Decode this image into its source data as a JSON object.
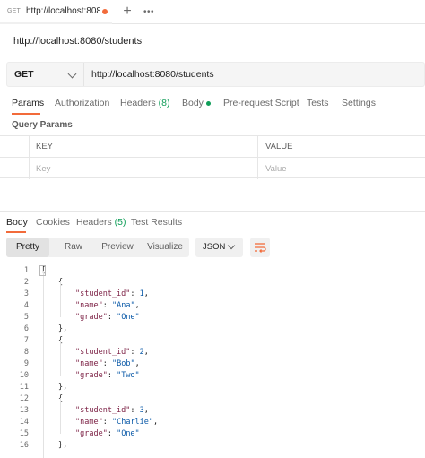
{
  "tab": {
    "method": "GET",
    "title": "http://localhost:8080/s",
    "unsaved_color": "#f26b3a"
  },
  "request": {
    "title": "http://localhost:8080/students",
    "method": "GET",
    "url": "http://localhost:8080/students"
  },
  "request_tabs": [
    {
      "label": "Params"
    },
    {
      "label": "Authorization"
    },
    {
      "label": "Headers",
      "count": "(8)"
    },
    {
      "label": "Body"
    },
    {
      "label": "Pre-request Script"
    },
    {
      "label": "Tests"
    },
    {
      "label": "Settings"
    }
  ],
  "query_params": {
    "label": "Query Params",
    "headers": [
      "KEY",
      "VALUE"
    ],
    "key_placeholder": "Key",
    "value_placeholder": "Value"
  },
  "response_tabs": [
    {
      "label": "Body"
    },
    {
      "label": "Cookies"
    },
    {
      "label": "Headers",
      "count": "(5)"
    },
    {
      "label": "Test Results"
    }
  ],
  "response_toolbar": {
    "modes": [
      "Pretty",
      "Raw",
      "Preview",
      "Visualize"
    ],
    "format": "JSON"
  },
  "code_lines": [
    {
      "n": "1",
      "indent": 0,
      "tokens": [
        [
          "p",
          "["
        ]
      ]
    },
    {
      "n": "2",
      "indent": 1,
      "tokens": [
        [
          "p",
          "{"
        ]
      ]
    },
    {
      "n": "3",
      "indent": 2,
      "tokens": [
        [
          "k",
          "\"student_id\""
        ],
        [
          "p",
          ": "
        ],
        [
          "n",
          "1"
        ],
        [
          "p",
          ","
        ]
      ]
    },
    {
      "n": "4",
      "indent": 2,
      "tokens": [
        [
          "k",
          "\"name\""
        ],
        [
          "p",
          ": "
        ],
        [
          "s",
          "\"Ana\""
        ],
        [
          "p",
          ","
        ]
      ]
    },
    {
      "n": "5",
      "indent": 2,
      "tokens": [
        [
          "k",
          "\"grade\""
        ],
        [
          "p",
          ": "
        ],
        [
          "s",
          "\"One\""
        ]
      ]
    },
    {
      "n": "6",
      "indent": 1,
      "tokens": [
        [
          "p",
          "},"
        ]
      ]
    },
    {
      "n": "7",
      "indent": 1,
      "tokens": [
        [
          "p",
          "{"
        ]
      ]
    },
    {
      "n": "8",
      "indent": 2,
      "tokens": [
        [
          "k",
          "\"student_id\""
        ],
        [
          "p",
          ": "
        ],
        [
          "n",
          "2"
        ],
        [
          "p",
          ","
        ]
      ]
    },
    {
      "n": "9",
      "indent": 2,
      "tokens": [
        [
          "k",
          "\"name\""
        ],
        [
          "p",
          ": "
        ],
        [
          "s",
          "\"Bob\""
        ],
        [
          "p",
          ","
        ]
      ]
    },
    {
      "n": "10",
      "indent": 2,
      "tokens": [
        [
          "k",
          "\"grade\""
        ],
        [
          "p",
          ": "
        ],
        [
          "s",
          "\"Two\""
        ]
      ]
    },
    {
      "n": "11",
      "indent": 1,
      "tokens": [
        [
          "p",
          "},"
        ]
      ]
    },
    {
      "n": "12",
      "indent": 1,
      "tokens": [
        [
          "p",
          "{"
        ]
      ]
    },
    {
      "n": "13",
      "indent": 2,
      "tokens": [
        [
          "k",
          "\"student_id\""
        ],
        [
          "p",
          ": "
        ],
        [
          "n",
          "3"
        ],
        [
          "p",
          ","
        ]
      ]
    },
    {
      "n": "14",
      "indent": 2,
      "tokens": [
        [
          "k",
          "\"name\""
        ],
        [
          "p",
          ": "
        ],
        [
          "s",
          "\"Charlie\""
        ],
        [
          "p",
          ","
        ]
      ]
    },
    {
      "n": "15",
      "indent": 2,
      "tokens": [
        [
          "k",
          "\"grade\""
        ],
        [
          "p",
          ": "
        ],
        [
          "s",
          "\"One\""
        ]
      ]
    },
    {
      "n": "16",
      "indent": 1,
      "tokens": [
        [
          "p",
          "},"
        ]
      ]
    }
  ],
  "colors": {
    "accent": "#f26b3a",
    "success": "#0f9d58",
    "json_key": "#7b1f43",
    "json_value": "#0b5aa8"
  }
}
